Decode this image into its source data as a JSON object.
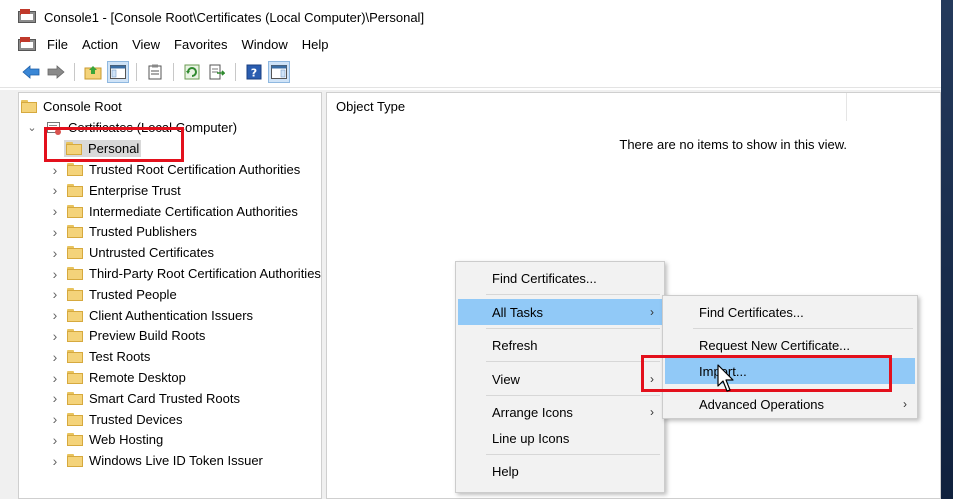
{
  "window": {
    "title": "Console1 - [Console Root\\Certificates (Local Computer)\\Personal]"
  },
  "menubar": {
    "items": [
      "File",
      "Action",
      "View",
      "Favorites",
      "Window",
      "Help"
    ]
  },
  "toolbar": {
    "buttons": [
      "back-arrow-icon",
      "forward-arrow-icon",
      "up-folder-icon",
      "show-hide-tree-icon",
      "properties-icon",
      "refresh-icon",
      "export-list-icon",
      "help-icon",
      "show-hide-action-pane-icon"
    ]
  },
  "tree": {
    "root": "Console Root",
    "certificates": "Certificates (Local Computer)",
    "personal": "Personal",
    "stores": [
      "Trusted Root Certification Authorities",
      "Enterprise Trust",
      "Intermediate Certification Authorities",
      "Trusted Publishers",
      "Untrusted Certificates",
      "Third-Party Root Certification Authorities",
      "Trusted People",
      "Client Authentication Issuers",
      "Preview Build Roots",
      "Test Roots",
      "Remote Desktop",
      "Smart Card Trusted Roots",
      "Trusted Devices",
      "Web Hosting",
      "Windows Live ID Token Issuer"
    ]
  },
  "list": {
    "column_header": "Object Type",
    "empty_message": "There are no items to show in this view."
  },
  "context_menu": {
    "items": [
      "Find Certificates...",
      "All Tasks",
      "Refresh",
      "View",
      "Arrange Icons",
      "Line up Icons",
      "Help"
    ],
    "submenu_arrow": "›"
  },
  "submenu": {
    "items": [
      "Find Certificates...",
      "Request New Certificate...",
      "Import...",
      "Advanced Operations"
    ]
  },
  "colors": {
    "highlight_box": "#e3101c",
    "menu_highlight": "#91c9f7",
    "selected_tree": "#d9d9d9"
  }
}
